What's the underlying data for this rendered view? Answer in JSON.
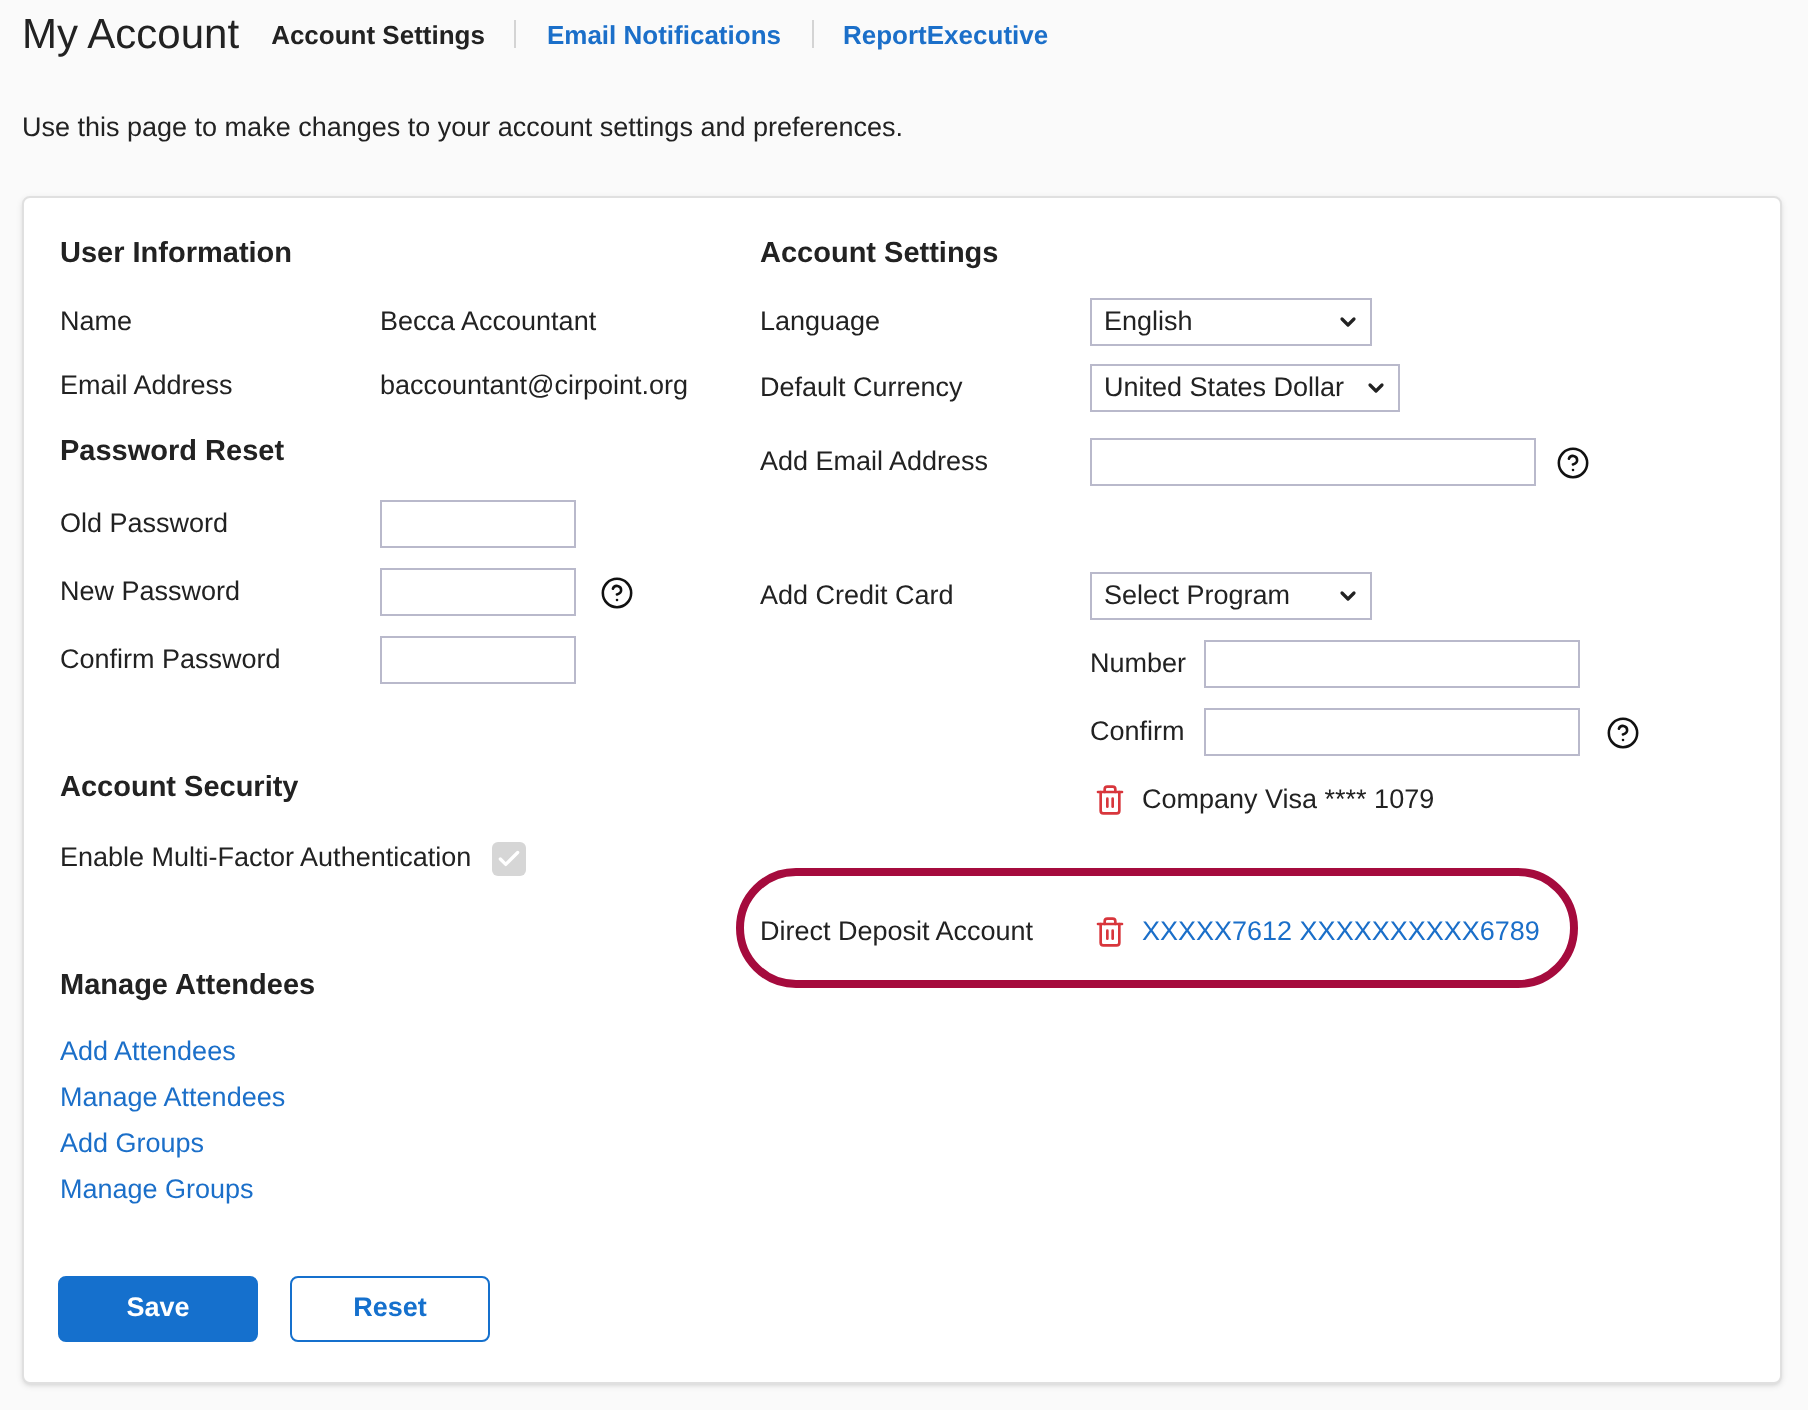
{
  "header": {
    "title": "My Account",
    "tabs": [
      {
        "label": "Account Settings",
        "selected": true
      },
      {
        "label": "Email Notifications",
        "selected": false
      },
      {
        "label": "ReportExecutive",
        "selected": false
      }
    ]
  },
  "intro": "Use this page to make changes to your account settings and preferences.",
  "user_information": {
    "heading": "User Information",
    "fields": [
      {
        "label": "Name",
        "value": "Becca Accountant"
      },
      {
        "label": "Email Address",
        "value": "baccountant@cirpoint.org"
      }
    ]
  },
  "password_reset": {
    "heading": "Password Reset",
    "fields": [
      {
        "label": "Old Password",
        "help": false
      },
      {
        "label": "New Password",
        "help": true
      },
      {
        "label": "Confirm Password",
        "help": false
      }
    ]
  },
  "account_security": {
    "heading": "Account Security",
    "mfa": {
      "label": "Enable Multi-Factor Authentication",
      "checked": true,
      "disabled": true
    }
  },
  "manage_attendees": {
    "heading": "Manage Attendees",
    "links": [
      "Add Attendees",
      "Manage Attendees",
      "Add Groups",
      "Manage Groups"
    ]
  },
  "buttons": [
    {
      "label": "Save",
      "kind": "primary"
    },
    {
      "label": "Reset",
      "kind": "secondary"
    }
  ],
  "account_settings": {
    "heading": "Account Settings",
    "language": {
      "label": "Language",
      "value": "English"
    },
    "currency": {
      "label": "Default Currency",
      "value": "United States Dollar"
    },
    "add_email": {
      "label": "Add Email Address",
      "help": true
    },
    "credit_card": {
      "label": "Add Credit Card",
      "program": "Select Program",
      "fields": [
        {
          "label": "Number",
          "help": false
        },
        {
          "label": "Confirm",
          "help": true
        }
      ],
      "saved_card": "Company Visa **** 1079"
    },
    "direct_deposit": {
      "label": "Direct Deposit Account",
      "account": "XXXXX7612 XXXXXXXXXX6789",
      "highlighted": true
    }
  }
}
